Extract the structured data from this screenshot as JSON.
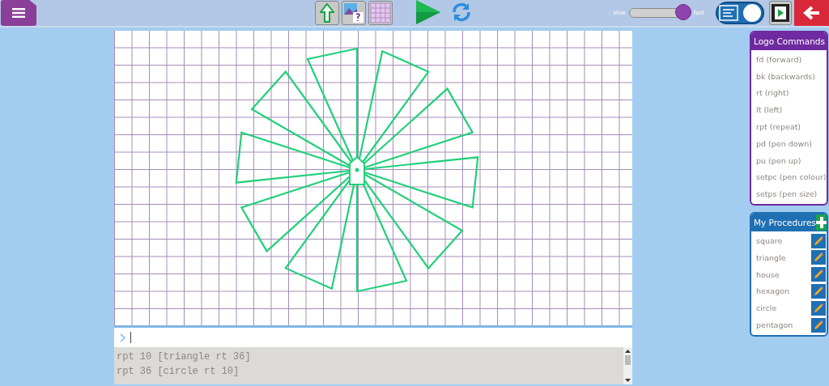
{
  "toolbar": {
    "speed_slider": {
      "min_label": "slow",
      "max_label": "fast",
      "level": 1
    },
    "view_toggle": {
      "on": true
    }
  },
  "logo_commands": {
    "title": "Logo Commands",
    "items": [
      "fd (forward)",
      "bk (backwards)",
      "rt (right)",
      "lt (left)",
      "rpt (repeat)",
      "pd (pen down)",
      "pu (pen up)",
      "setpc (pen colour)",
      "setps (pen size)"
    ]
  },
  "procedures": {
    "title": "My Procedures",
    "items": [
      "square",
      "triangle",
      "house",
      "hexagon",
      "circle",
      "pentagon"
    ]
  },
  "console": {
    "history": [
      "rpt 10 [triangle rt 36]",
      "rpt 36 [circle rt 10]"
    ]
  }
}
